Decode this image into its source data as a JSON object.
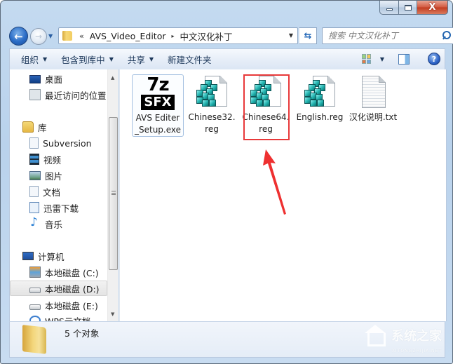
{
  "window": {
    "caption_buttons": {
      "minimize_icon": "minimize-icon",
      "maximize_icon": "maximize-icon",
      "close_icon": "close-icon",
      "close_glyph": "X"
    }
  },
  "nav": {
    "back_glyph": "←",
    "forward_glyph": "→",
    "recent_glyph": "▼",
    "address": {
      "overflow_glyph": "«",
      "breadcrumbs": [
        "AVS_Video_Editor",
        "中文汉化补丁"
      ],
      "separator_glyph": "▸",
      "dropdown_glyph": "▼"
    },
    "refresh_glyph": "⇆",
    "search": {
      "placeholder": "搜索 中文汉化补丁",
      "value": ""
    }
  },
  "commandbar": {
    "items": [
      {
        "label": "组织",
        "has_menu": true
      },
      {
        "label": "包含到库中",
        "has_menu": true
      },
      {
        "label": "共享",
        "has_menu": true
      },
      {
        "label": "新建文件夹",
        "has_menu": false
      }
    ],
    "caret_glyph": "▼",
    "help_glyph": "?"
  },
  "sidebar": {
    "items": [
      {
        "label": "桌面",
        "icon": "desktop-icon"
      },
      {
        "label": "最近访问的位置",
        "icon": "recent-places-icon"
      },
      {
        "label": "库",
        "icon": "libraries-icon"
      },
      {
        "label": "Subversion",
        "icon": "document-library-icon"
      },
      {
        "label": "视频",
        "icon": "video-icon"
      },
      {
        "label": "图片",
        "icon": "pictures-icon"
      },
      {
        "label": "文档",
        "icon": "documents-icon"
      },
      {
        "label": "迅雷下载",
        "icon": "xunlei-download-icon"
      },
      {
        "label": "音乐",
        "icon": "music-icon"
      },
      {
        "label": "计算机",
        "icon": "computer-icon"
      },
      {
        "label": "本地磁盘 (C:)",
        "icon": "system-drive-icon"
      },
      {
        "label": "本地磁盘 (D:)",
        "icon": "drive-icon",
        "selected": true
      },
      {
        "label": "本地磁盘 (E:)",
        "icon": "drive-icon"
      },
      {
        "label": "WPS云文档",
        "icon": "wps-cloud-icon"
      }
    ],
    "scroll_up_glyph": "▲",
    "scroll_down_glyph": "▼"
  },
  "files": [
    {
      "name": "AVS Editer_Setup.exe",
      "icon": "7z-sfx-icon",
      "icon_top": "7z",
      "icon_bottom": "SFX",
      "selected": true
    },
    {
      "name": "Chinese32.reg",
      "icon": "registry-file-icon"
    },
    {
      "name": "Chinese64.reg",
      "icon": "registry-file-icon",
      "highlighted": true
    },
    {
      "name": "English.reg",
      "icon": "registry-file-icon"
    },
    {
      "name": "汉化说明.txt",
      "icon": "text-file-icon"
    }
  ],
  "annotation": {
    "highlight_color": "#e8393a",
    "arrow_color": "#ee3030"
  },
  "details": {
    "count_text": "5 个对象"
  },
  "watermark": {
    "text": "系统之家",
    "subtext": "XITONGZHIJIA.NET"
  }
}
